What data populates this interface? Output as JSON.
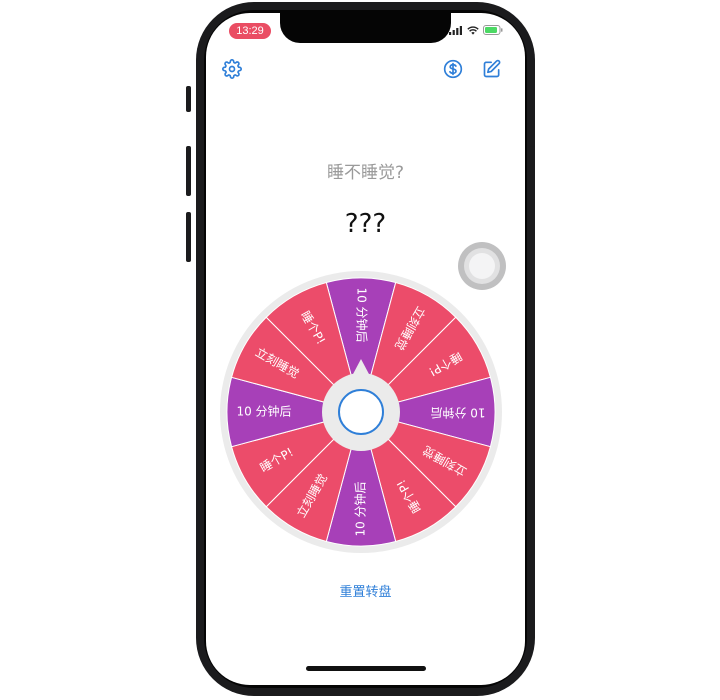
{
  "status_bar": {
    "time": "13:29",
    "icons": [
      "signal-icon",
      "wifi-icon",
      "battery-icon"
    ]
  },
  "top_bar": {
    "icons": [
      "gear-icon",
      "dollar-coin-icon",
      "edit-icon"
    ]
  },
  "wheel": {
    "question": "睡不睡觉?",
    "result": "???",
    "segments": [
      {
        "label": "10 分钟后",
        "color": "#a740b8"
      },
      {
        "label": "立刻睡觉",
        "color": "#ec4c6a"
      },
      {
        "label": "睡个P!",
        "color": "#ec4c6a"
      },
      {
        "label": "10 分钟后",
        "color": "#a740b8"
      },
      {
        "label": "立刻睡觉",
        "color": "#ec4c6a"
      },
      {
        "label": "睡个P!",
        "color": "#ec4c6a"
      },
      {
        "label": "10 分钟后",
        "color": "#a740b8"
      },
      {
        "label": "立刻睡觉",
        "color": "#ec4c6a"
      },
      {
        "label": "睡个P!",
        "color": "#ec4c6a"
      },
      {
        "label": "10 分钟后",
        "color": "#a740b8"
      },
      {
        "label": "立刻睡觉",
        "color": "#ec4c6a"
      },
      {
        "label": "睡个P!",
        "color": "#ec4c6a"
      }
    ],
    "rim_color": "#ebebeb",
    "pointer_ring_color": "#2f7fd8"
  },
  "reset_label": "重置转盘",
  "accent_color": "#2f7fd8"
}
